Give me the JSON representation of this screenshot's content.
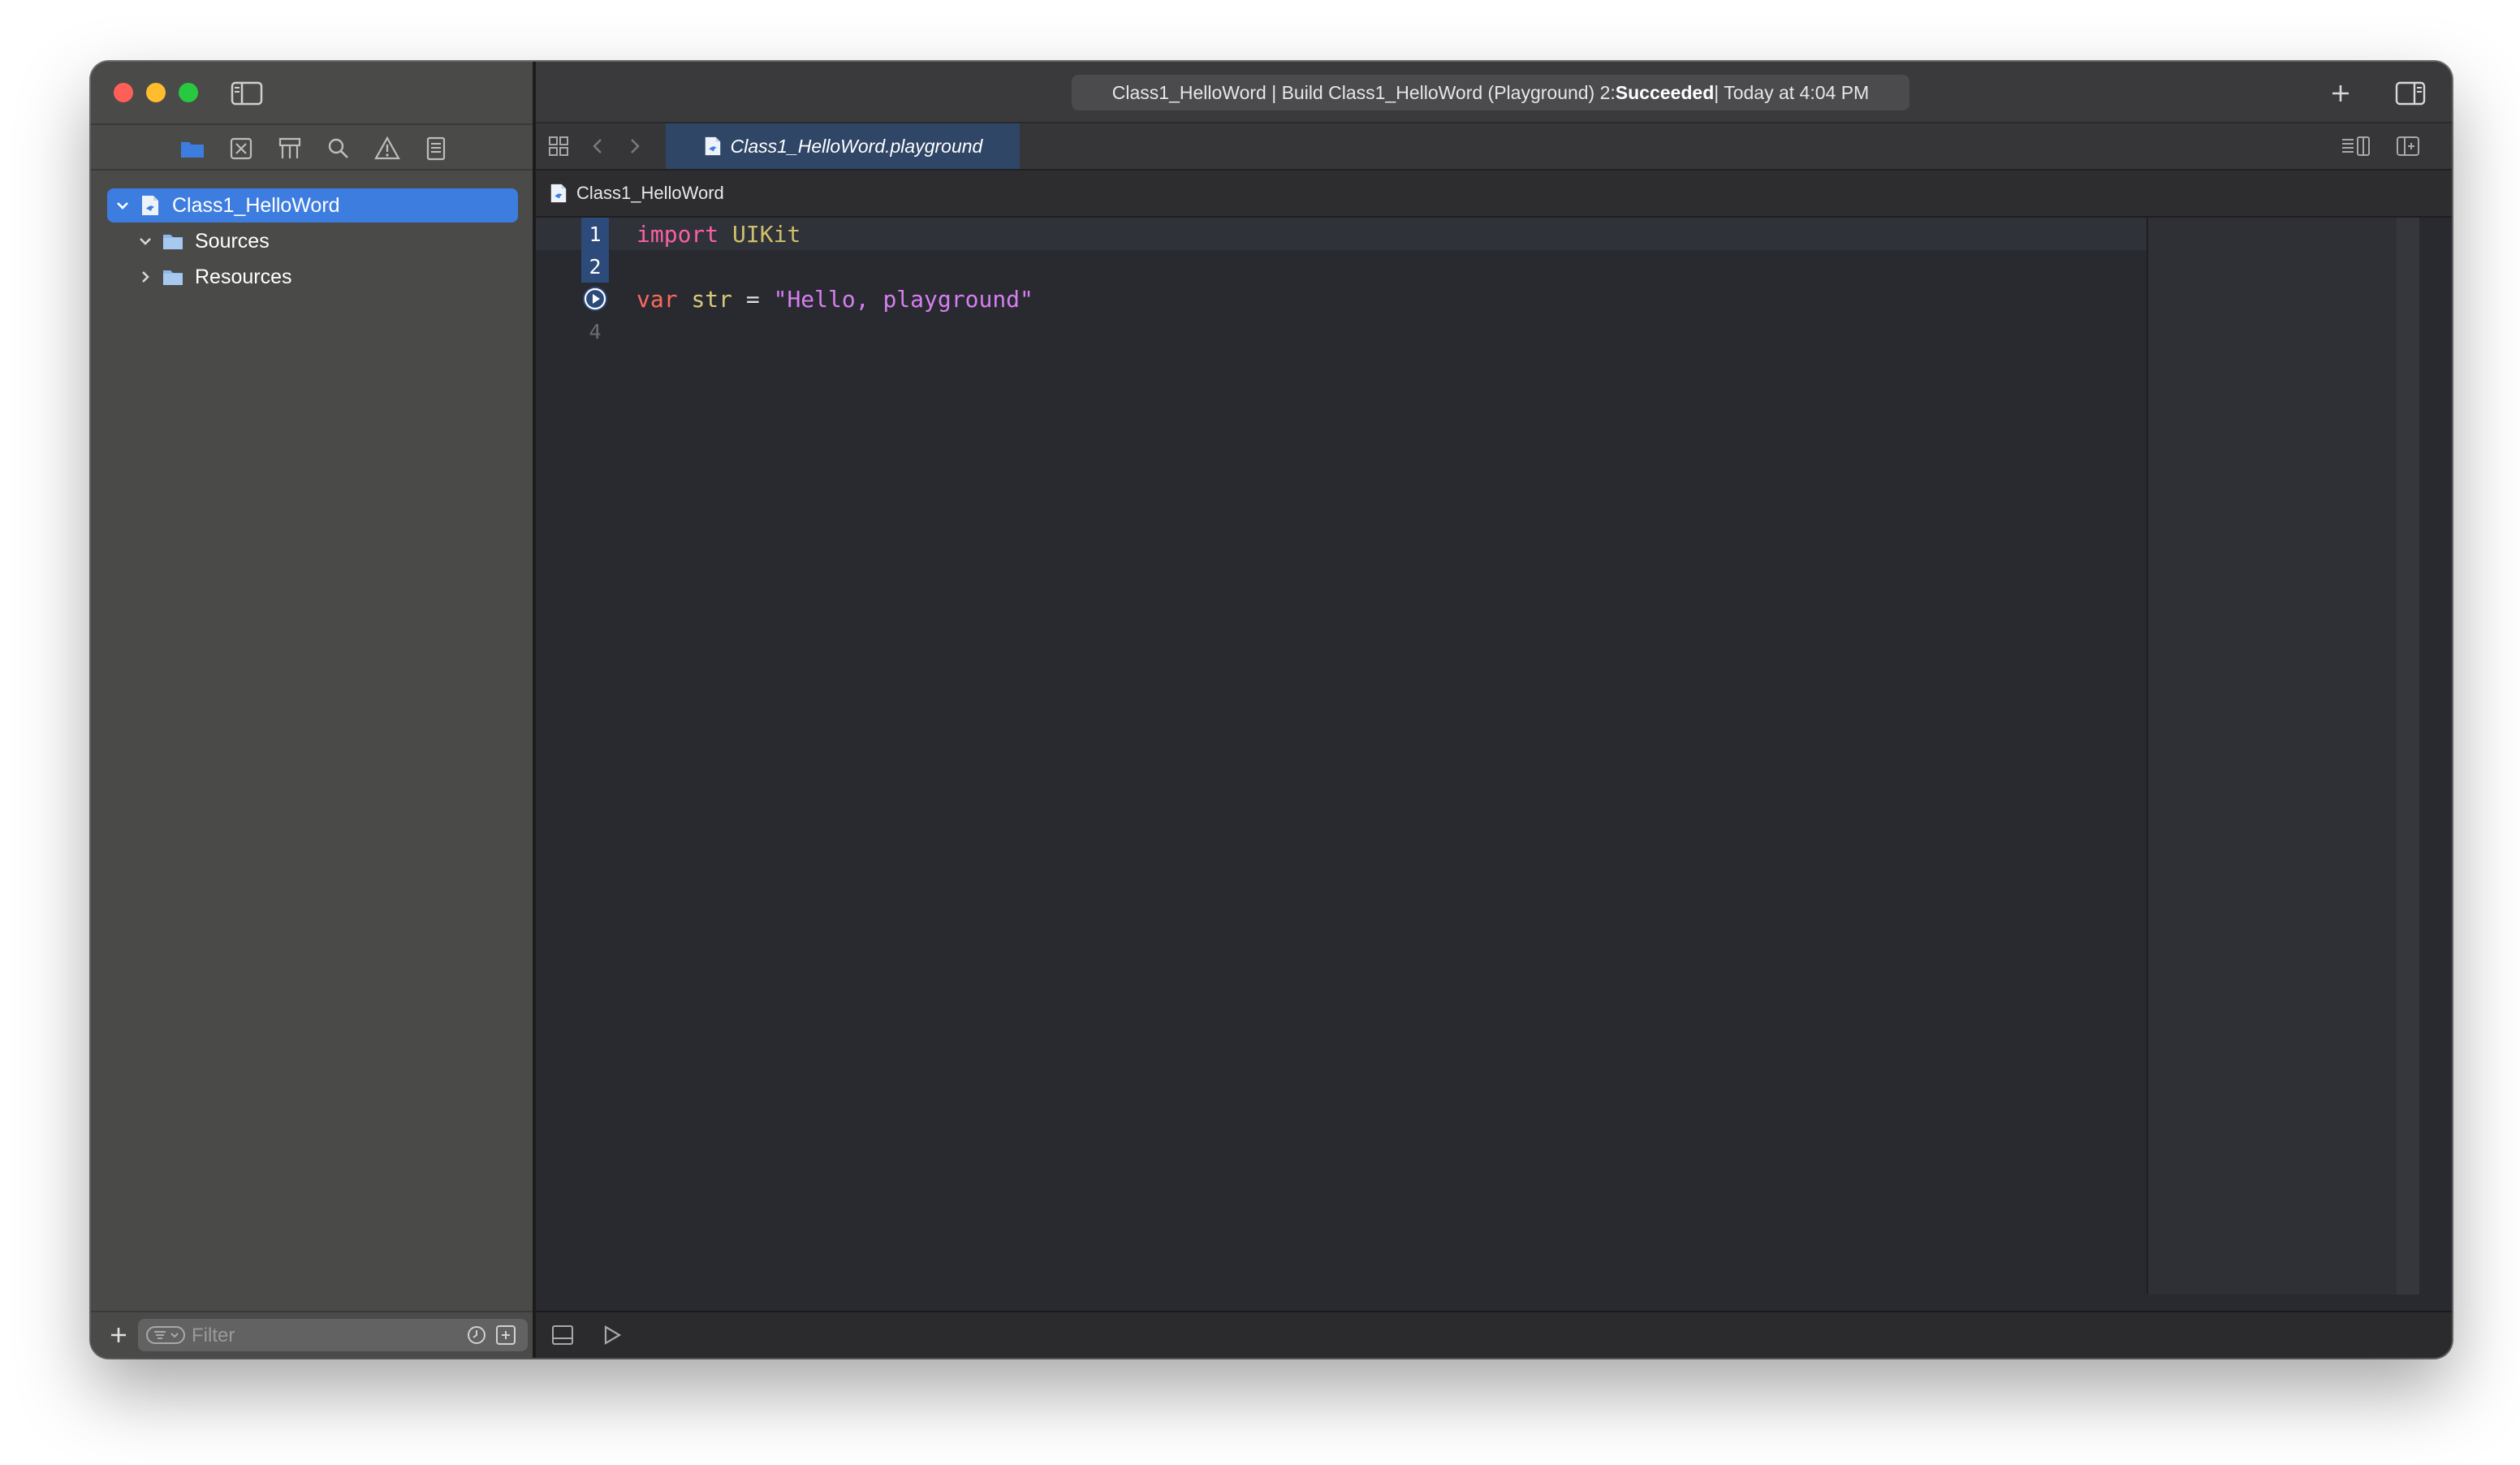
{
  "window": {
    "status": {
      "prefix": "Class1_HelloWord | Build Class1_HelloWord (Playground) 2: ",
      "result": "Succeeded",
      "suffix": " | Today at 4:04 PM"
    }
  },
  "sidebar": {
    "nav_tab_icons": [
      "folder-icon",
      "source-control-icon",
      "symbol-navigator-icon",
      "find-icon",
      "issue-warning-icon",
      "report-icon"
    ],
    "tree": [
      {
        "label": "Class1_HelloWord",
        "icon": "playground-file-icon",
        "expanded": true,
        "selected": true
      },
      {
        "label": "Sources",
        "icon": "folder-icon",
        "expanded": true
      },
      {
        "label": "Resources",
        "icon": "folder-icon",
        "expanded": false
      }
    ],
    "filter": {
      "placeholder": "Filter"
    }
  },
  "editor": {
    "tab_label": "Class1_HelloWord.playground",
    "breadcrumb": "Class1_HelloWord",
    "line_numbers": [
      "1",
      "2",
      "",
      "4"
    ],
    "lines": [
      {
        "keyword": "import",
        "type": "UIKit"
      },
      {},
      {
        "keyword": "var",
        "name": "str",
        "op": "=",
        "string": "\"Hello, playground\""
      },
      {}
    ]
  },
  "colors": {
    "accent": "#3e7de0",
    "keyword": "#fc5fa3",
    "string": "#d57ff0",
    "type": "#d0bf69",
    "sidebar_bg": "#4a4a49",
    "editor_bg": "#292a30"
  }
}
